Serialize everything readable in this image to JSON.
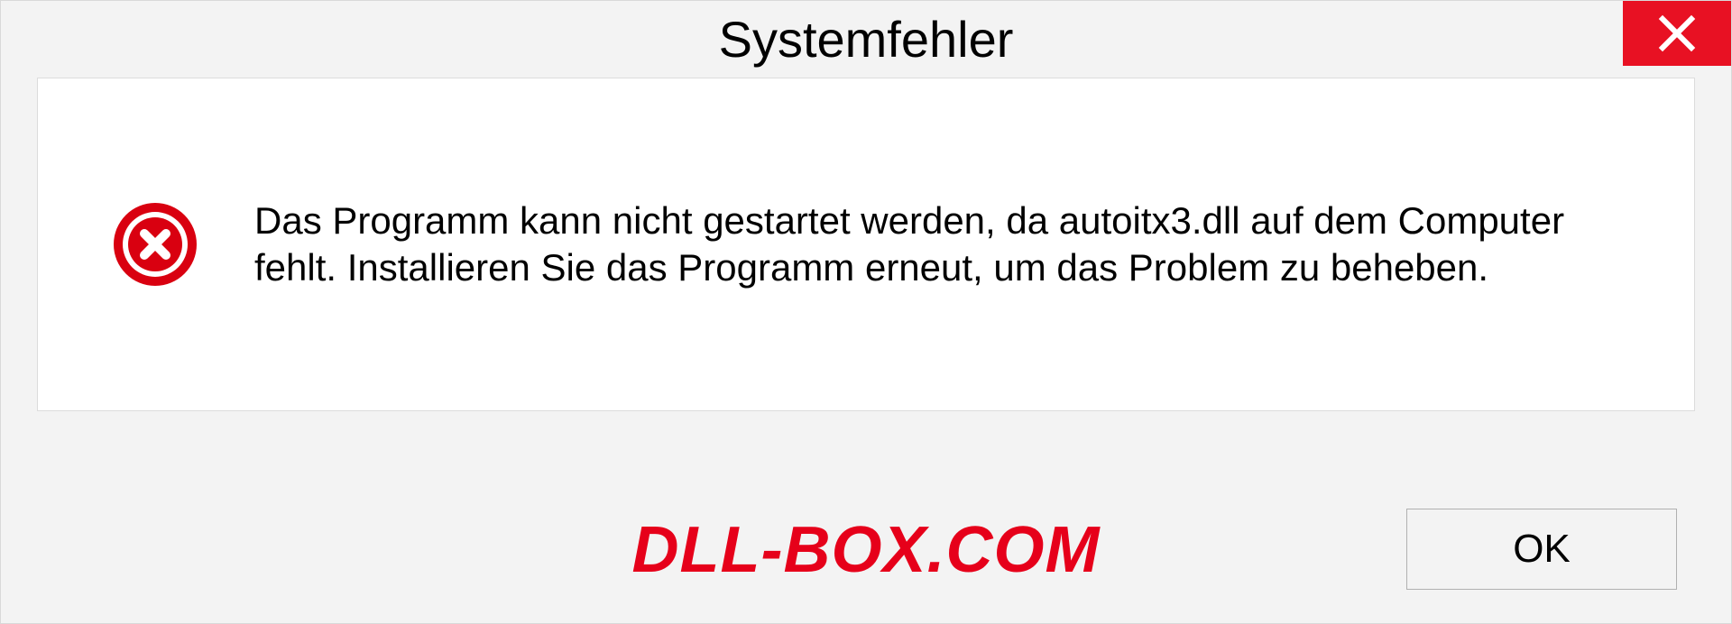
{
  "dialog": {
    "title": "Systemfehler",
    "message": "Das Programm kann nicht gestartet werden, da autoitx3.dll auf dem Computer fehlt. Installieren Sie das Programm erneut, um das Problem zu beheben.",
    "ok_label": "OK"
  },
  "watermark": "DLL-BOX.COM",
  "colors": {
    "close_bg": "#e81123",
    "error_icon": "#d90010",
    "watermark": "#e6001a"
  }
}
